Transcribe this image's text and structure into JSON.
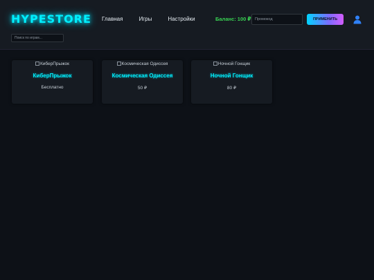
{
  "header": {
    "logo": "HYPESTORE",
    "nav": [
      {
        "label": "Главная"
      },
      {
        "label": "Игры"
      },
      {
        "label": "Настройки"
      }
    ],
    "balance": "Баланс: 100 ₽",
    "promo_placeholder": "Промокод",
    "apply_label": "ПРИМЕНИТЬ",
    "user_icon": "user-icon"
  },
  "search": {
    "placeholder": "Поиск по играм..."
  },
  "games": [
    {
      "image_alt": "КиберПрыжок",
      "title": "КиберПрыжок",
      "price": "Бесплатно"
    },
    {
      "image_alt": "Космическая Одиссея",
      "title": "Космическая Одиссея",
      "price": "50 ₽"
    },
    {
      "image_alt": "Ночной Гонщик",
      "title": "Ночной Гонщик",
      "price": "80 ₽"
    }
  ],
  "colors": {
    "background": "#0d1117",
    "header": "#161b22",
    "accent": "#00f0ff",
    "balance": "#39d353"
  }
}
